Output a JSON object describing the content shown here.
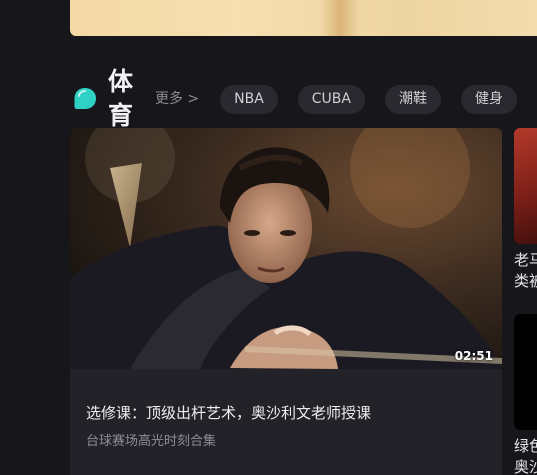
{
  "colors": {
    "background": "#17161b",
    "card": "#232228",
    "tag_bg": "#2a292f",
    "accent": "#2fd1c4"
  },
  "section": {
    "icon": "chat-bubble-icon",
    "title": "体育",
    "more_label": "更多 >",
    "tags": [
      "NBA",
      "CUBA",
      "潮鞋",
      "健身"
    ]
  },
  "feature": {
    "duration": "02:51",
    "title": "选修课：顶级出杆艺术，奥沙利文老师授课",
    "subtitle": "台球赛场高光时刻合集"
  },
  "side": {
    "card1_line1": "老马",
    "card1_line2": "类被",
    "card2_line1": "绿色",
    "card2_line2": "奥沙"
  }
}
